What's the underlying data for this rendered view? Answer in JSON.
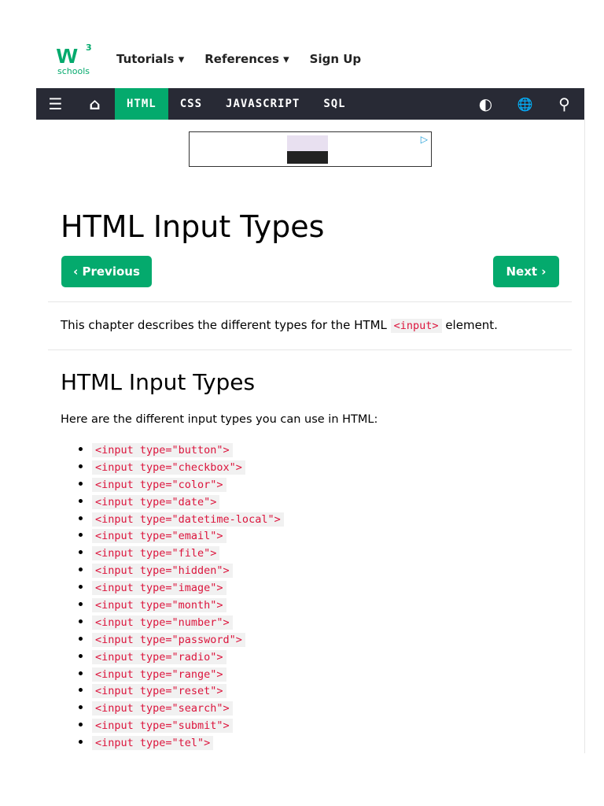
{
  "logo": {
    "text": "w",
    "sup": "3",
    "sub": "schools"
  },
  "topnav": {
    "tutorials": "Tutorials ▾",
    "references": "References ▾",
    "signup": "Sign Up"
  },
  "navbar": {
    "menu_icon": "☰",
    "home_icon": "⌂",
    "items": [
      "HTML",
      "CSS",
      "JAVASCRIPT",
      "SQL"
    ],
    "contrast_icon": "◐",
    "globe_icon": "🌐",
    "search_icon": "⚲"
  },
  "ad": {
    "badge": "▷"
  },
  "page": {
    "title": "HTML Input Types",
    "prev": "‹ Previous",
    "next": "Next ›",
    "intro_before": "This chapter describes the different types for the HTML ",
    "intro_code": "<input>",
    "intro_after": " element.",
    "h2": "HTML Input Types",
    "para": "Here are the different input types you can use in HTML:",
    "types": [
      "<input type=\"button\">",
      "<input type=\"checkbox\">",
      "<input type=\"color\">",
      "<input type=\"date\">",
      "<input type=\"datetime-local\">",
      "<input type=\"email\">",
      "<input type=\"file\">",
      "<input type=\"hidden\">",
      "<input type=\"image\">",
      "<input type=\"month\">",
      "<input type=\"number\">",
      "<input type=\"password\">",
      "<input type=\"radio\">",
      "<input type=\"range\">",
      "<input type=\"reset\">",
      "<input type=\"search\">",
      "<input type=\"submit\">",
      "<input type=\"tel\">"
    ]
  }
}
